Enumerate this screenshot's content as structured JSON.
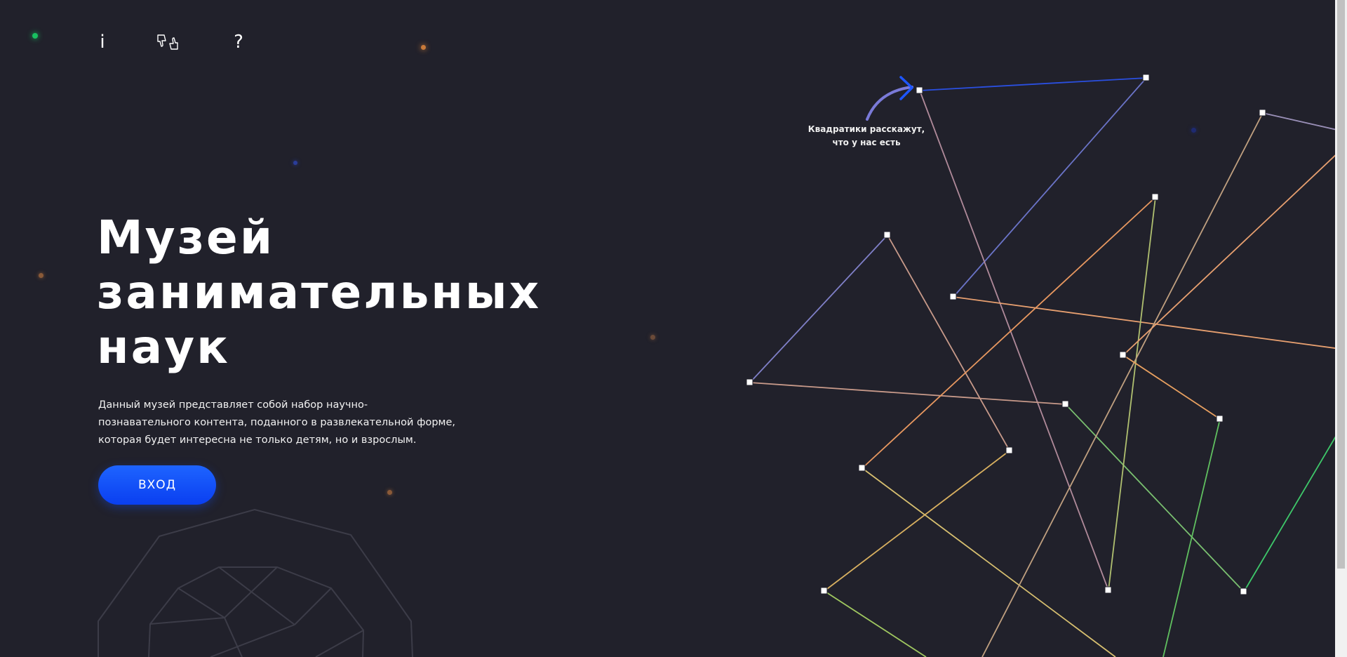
{
  "nav": {
    "info_label": "i",
    "help_label": "?",
    "rate_icon": "thumbs-down-up-icon"
  },
  "hero": {
    "title_lines": [
      "Музей",
      "занимательных",
      "наук"
    ],
    "description_lines": [
      "Данный музей представляет собой набор научно-",
      "познавательного контента, поданного в развлекательной форме,",
      "которая будет интересна не только детям, но и взрослым."
    ],
    "enter_button": "ВХОД"
  },
  "hint": {
    "lines": [
      "Квадратики расскажут,",
      "что у нас есть"
    ]
  },
  "colors": {
    "background": "#21212b",
    "accent": "#1450ff",
    "line_blue": "#2a4fe0",
    "line_orange": "#f0a060",
    "line_green": "#3ec86a"
  }
}
